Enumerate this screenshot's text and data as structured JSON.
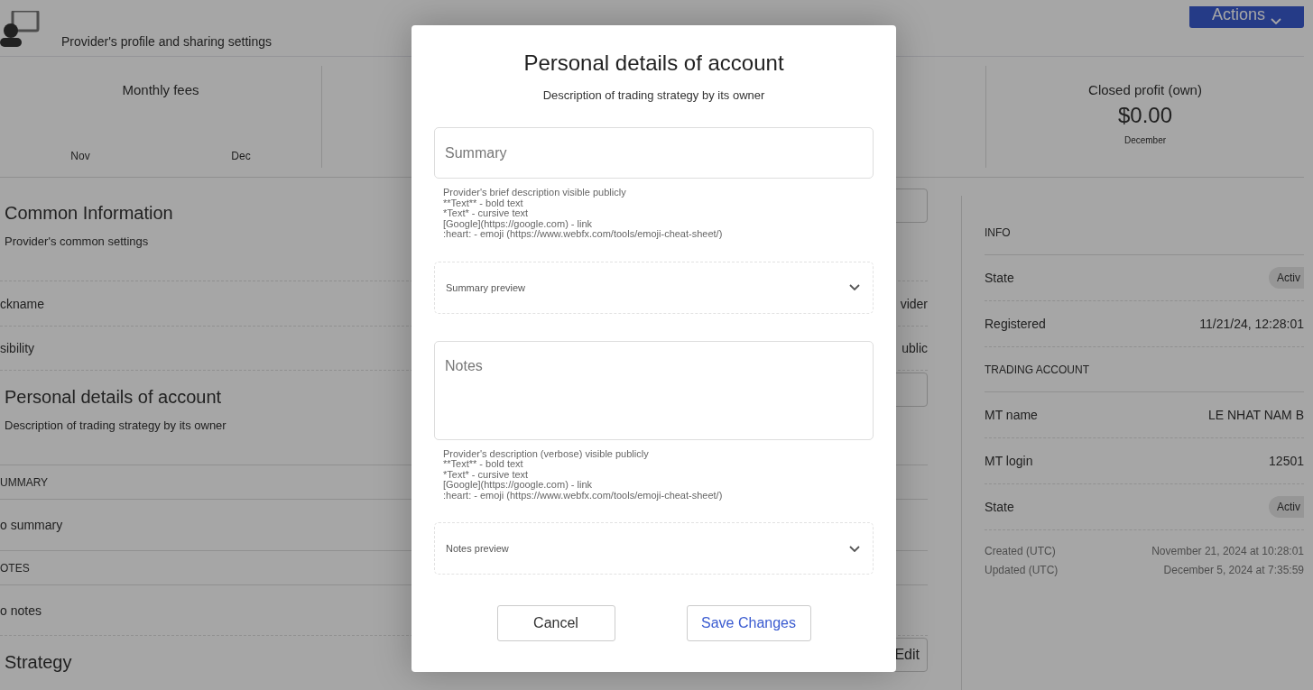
{
  "header": {
    "subtitle": "Provider's profile and sharing settings",
    "actions_button": "Actions"
  },
  "stats": [
    {
      "kind": "chart",
      "title": "Monthly fees",
      "labels": [
        "Nov",
        "Dec"
      ]
    },
    {
      "kind": "value",
      "title": "Closed profit (own)",
      "value": "$0.00",
      "caption": "December"
    }
  ],
  "sections": [
    {
      "title": "Common Information",
      "subtitle": "Provider's common settings",
      "editable": true,
      "rows": [
        {
          "kind": "field",
          "label": "ckname",
          "value": "vider"
        },
        {
          "kind": "field",
          "label": "sibility",
          "value": "ublic"
        }
      ]
    },
    {
      "title": "Personal details of account",
      "subtitle": "Description of trading strategy by its owner",
      "editable": true,
      "rows": [
        {
          "kind": "heading",
          "label": "UMMARY"
        },
        {
          "kind": "text",
          "label": "o summary"
        },
        {
          "kind": "heading",
          "label": "OTES"
        },
        {
          "kind": "text",
          "label": "o notes"
        }
      ]
    },
    {
      "title": "Strategy",
      "editable": true,
      "edit_label": "Edit"
    }
  ],
  "info": [
    {
      "kind": "heading",
      "label": "INFO"
    },
    {
      "kind": "badge",
      "label": "State",
      "value": "Activ"
    },
    {
      "kind": "row",
      "label": "Registered",
      "value": "11/21/24, 12:28:01"
    },
    {
      "kind": "heading",
      "label": "TRADING ACCOUNT"
    },
    {
      "kind": "row",
      "label": "MT name",
      "value": "LE NHAT NAM B"
    },
    {
      "kind": "row",
      "label": "MT login",
      "value": "12501"
    },
    {
      "kind": "badge",
      "label": "State",
      "value": "Activ"
    },
    {
      "kind": "meta",
      "label": "Created (UTC)",
      "value": "November 21, 2024 at 10:28:01"
    },
    {
      "kind": "meta",
      "label": "Updated (UTC)",
      "value": "December 5, 2024 at 7:35:59"
    }
  ],
  "modal": {
    "title": "Personal details of account",
    "subtitle": "Description of trading strategy by its owner",
    "fields": [
      {
        "placeholder": "Summary",
        "multiline": false,
        "help": [
          "Provider's brief description visible publicly",
          "**Text** - bold text",
          "*Text* - cursive text",
          "[Google](https://google.com) - link",
          ":heart: - emoji (https://www.webfx.com/tools/emoji-cheat-sheet/)"
        ],
        "preview": "Summary preview"
      },
      {
        "placeholder": "Notes",
        "multiline": true,
        "help": [
          "Provider's description (verbose) visible publicly",
          "**Text** - bold text",
          "*Text* - cursive text",
          "[Google](https://google.com) - link",
          ":heart: - emoji (https://www.webfx.com/tools/emoji-cheat-sheet/)"
        ],
        "preview": "Notes preview"
      }
    ],
    "buttons": [
      {
        "label": "Cancel",
        "kind": "secondary"
      },
      {
        "label": "Save Changes",
        "kind": "primary"
      }
    ]
  }
}
